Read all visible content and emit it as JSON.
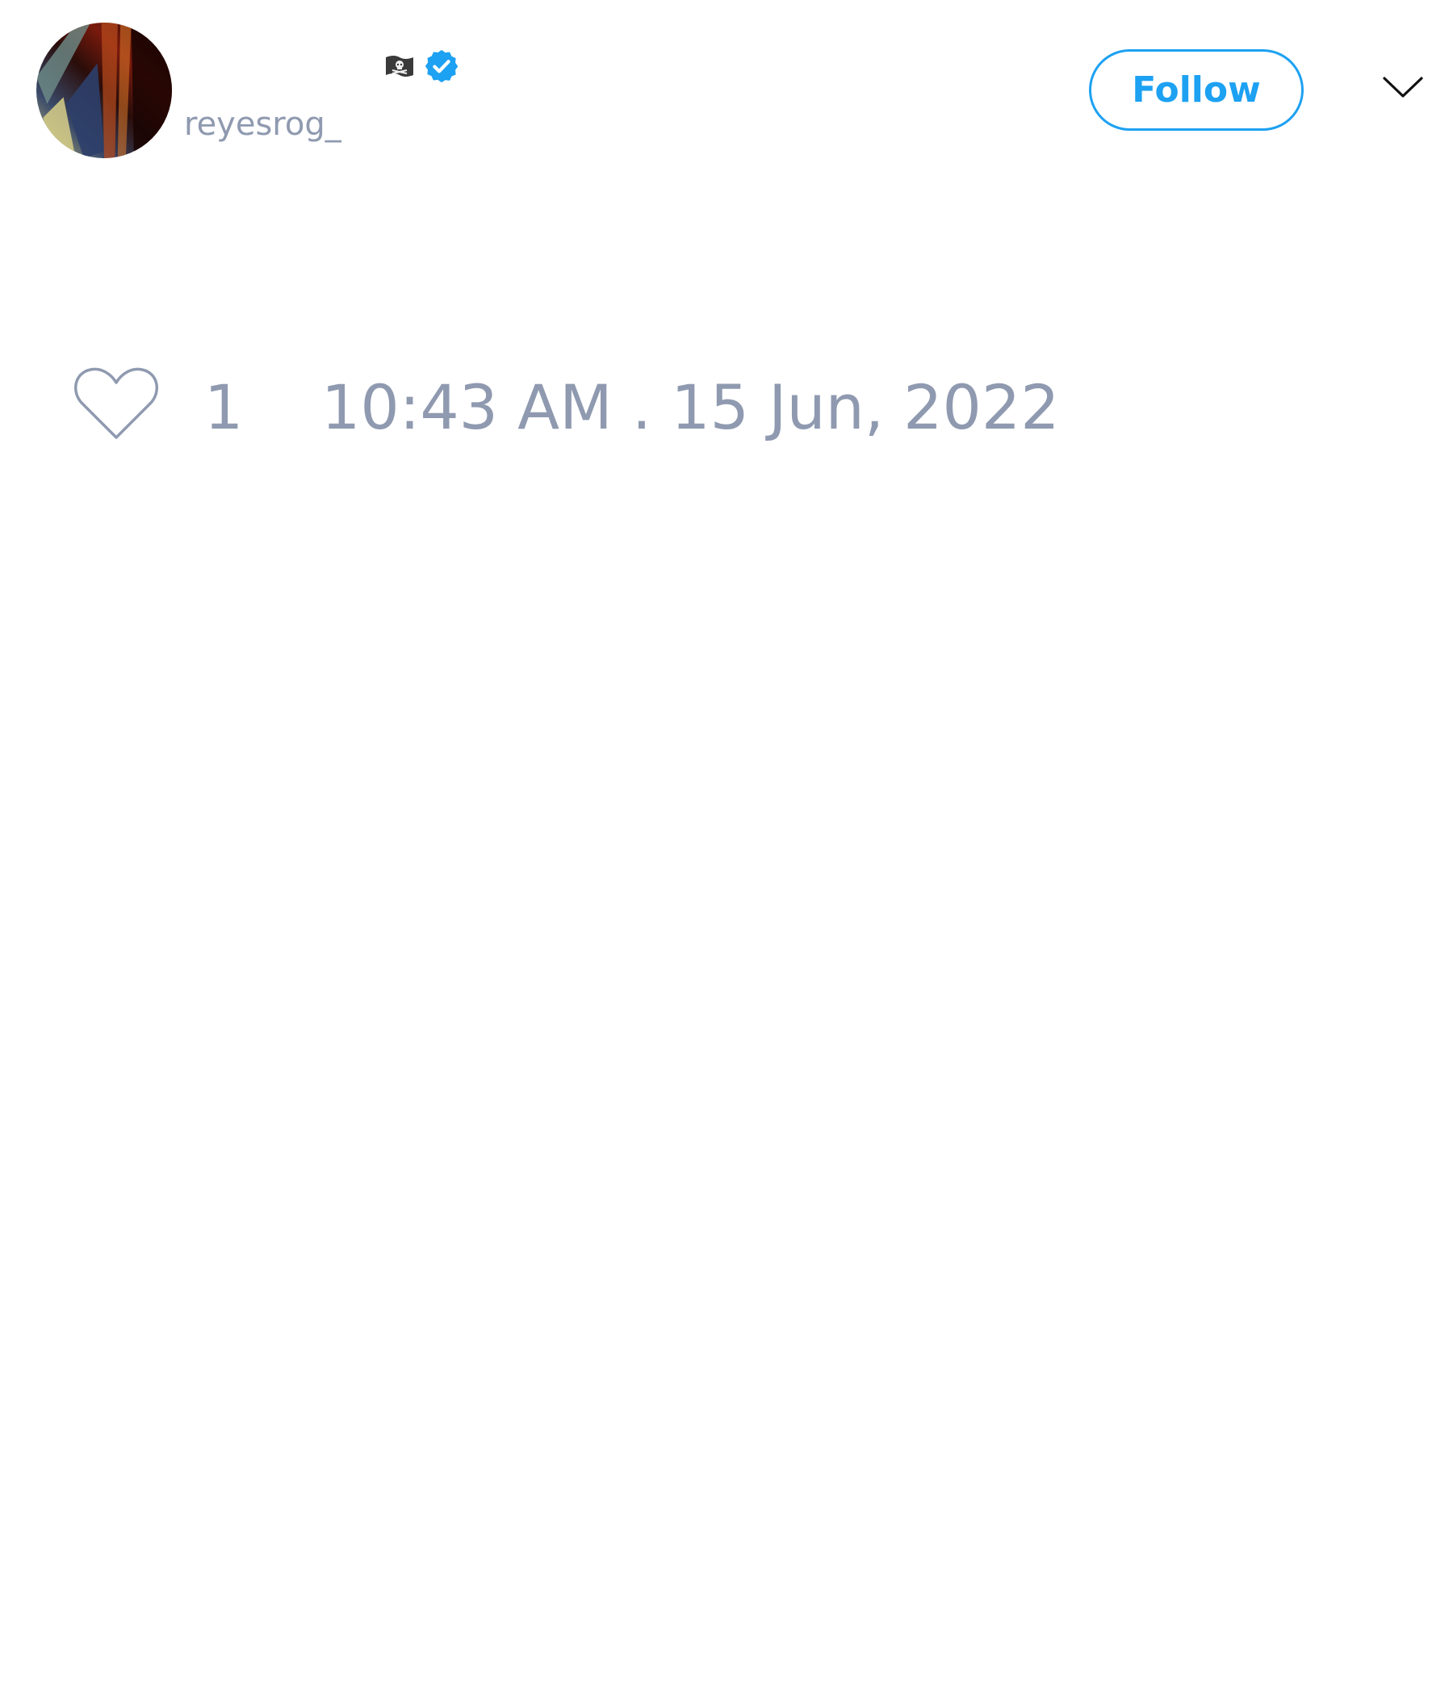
{
  "tweet": {
    "author": {
      "handle": "reyesrog_",
      "name_emoji_icon": "pirate-flag-icon",
      "verified_icon": "verified-badge-icon"
    },
    "follow_button": {
      "label": "Follow"
    },
    "menu_icon": "chevron-down-icon",
    "likes": {
      "icon": "heart-outline-icon",
      "count": "1"
    },
    "timestamp": "10:43 AM . 15 Jun, 2022"
  },
  "colors": {
    "accent": "#1da1f2",
    "muted_text": "#8f9ab0",
    "background": "#ffffff"
  }
}
